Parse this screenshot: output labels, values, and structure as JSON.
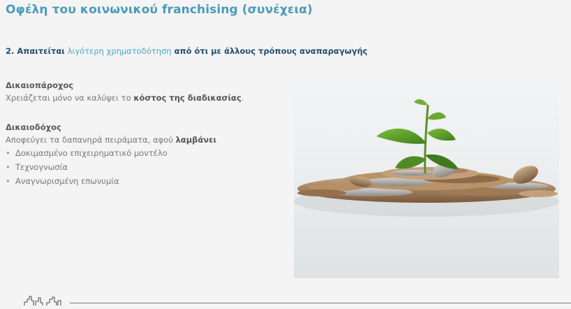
{
  "slide": {
    "title": "Οφέλη του κοινωνικού franchising (συνέχεια)",
    "subtitle": {
      "prefix": "2. Απαιτείται ",
      "highlight": "λιγότερη χρηματοδότηση",
      "suffix": " από ότι με άλλους τρόπους αναπαραγωγής"
    },
    "franchisor": {
      "heading": "Δικαιοπάροχος",
      "text_before": "Χρειάζεται μόνο να καλύψει το ",
      "text_bold": "κόστος της διαδικασίας",
      "text_after": "."
    },
    "franchisee": {
      "heading": "Δικαιοδόχος",
      "text_before": "Αποφεύγει τα δαπανηρά πειράματα, αφού ",
      "text_bold": "λαμβάνει",
      "bullet_symbol": "•",
      "bullets": [
        "Δοκιμασμένο επιχειρηματικό μοντέλο",
        "Τεχνογνωσία",
        "Αναγνωρισμένη επωνυμία"
      ]
    },
    "colors": {
      "title": "#4a9bb8",
      "subtitle": "#1f4e6e",
      "highlight": "#4aa7c8",
      "body_text": "#777777",
      "background": "#f4f4f4"
    },
    "image_subject": "coins-with-sprouting-plant-photo"
  }
}
